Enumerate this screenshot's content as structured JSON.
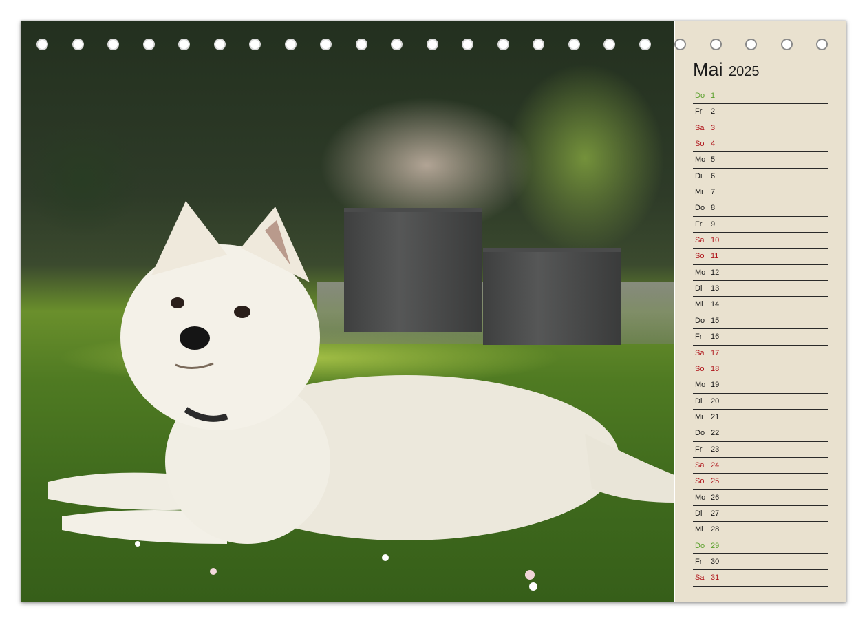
{
  "calendar": {
    "month": "Mai",
    "year": "2025",
    "colors": {
      "weekend": "#b0161c",
      "holiday": "#5aa02c",
      "panel_bg": "#e9e1cf"
    },
    "days": [
      {
        "wd": "Do",
        "d": "1",
        "kind": "holiday"
      },
      {
        "wd": "Fr",
        "d": "2",
        "kind": "normal"
      },
      {
        "wd": "Sa",
        "d": "3",
        "kind": "weekend"
      },
      {
        "wd": "So",
        "d": "4",
        "kind": "weekend"
      },
      {
        "wd": "Mo",
        "d": "5",
        "kind": "normal"
      },
      {
        "wd": "Di",
        "d": "6",
        "kind": "normal"
      },
      {
        "wd": "Mi",
        "d": "7",
        "kind": "normal"
      },
      {
        "wd": "Do",
        "d": "8",
        "kind": "normal"
      },
      {
        "wd": "Fr",
        "d": "9",
        "kind": "normal"
      },
      {
        "wd": "Sa",
        "d": "10",
        "kind": "weekend"
      },
      {
        "wd": "So",
        "d": "11",
        "kind": "weekend"
      },
      {
        "wd": "Mo",
        "d": "12",
        "kind": "normal"
      },
      {
        "wd": "Di",
        "d": "13",
        "kind": "normal"
      },
      {
        "wd": "Mi",
        "d": "14",
        "kind": "normal"
      },
      {
        "wd": "Do",
        "d": "15",
        "kind": "normal"
      },
      {
        "wd": "Fr",
        "d": "16",
        "kind": "normal"
      },
      {
        "wd": "Sa",
        "d": "17",
        "kind": "weekend"
      },
      {
        "wd": "So",
        "d": "18",
        "kind": "weekend"
      },
      {
        "wd": "Mo",
        "d": "19",
        "kind": "normal"
      },
      {
        "wd": "Di",
        "d": "20",
        "kind": "normal"
      },
      {
        "wd": "Mi",
        "d": "21",
        "kind": "normal"
      },
      {
        "wd": "Do",
        "d": "22",
        "kind": "normal"
      },
      {
        "wd": "Fr",
        "d": "23",
        "kind": "normal"
      },
      {
        "wd": "Sa",
        "d": "24",
        "kind": "weekend"
      },
      {
        "wd": "So",
        "d": "25",
        "kind": "weekend"
      },
      {
        "wd": "Mo",
        "d": "26",
        "kind": "normal"
      },
      {
        "wd": "Di",
        "d": "27",
        "kind": "normal"
      },
      {
        "wd": "Mi",
        "d": "28",
        "kind": "normal"
      },
      {
        "wd": "Do",
        "d": "29",
        "kind": "holiday"
      },
      {
        "wd": "Fr",
        "d": "30",
        "kind": "normal"
      },
      {
        "wd": "Sa",
        "d": "31",
        "kind": "weekend"
      }
    ]
  }
}
